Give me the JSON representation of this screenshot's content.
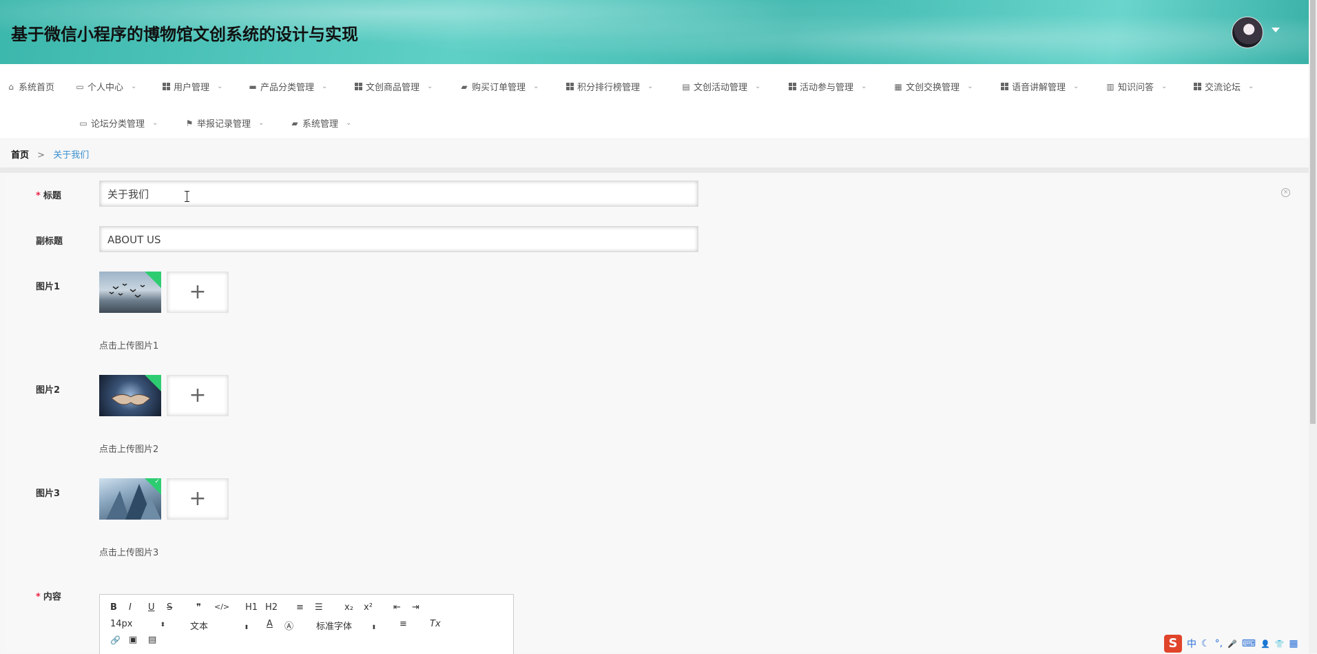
{
  "header": {
    "title": "基于微信小程序的博物馆文创系统的设计与实现"
  },
  "nav": {
    "row1": [
      {
        "label": "系统首页",
        "icon": "home-icon",
        "dropdown": false
      },
      {
        "label": "个人中心",
        "icon": "card-icon",
        "dropdown": true
      },
      {
        "label": "用户管理",
        "icon": "grid-icon",
        "dropdown": true
      },
      {
        "label": "产品分类管理",
        "icon": "comment-icon",
        "dropdown": true
      },
      {
        "label": "文创商品管理",
        "icon": "grid-icon",
        "dropdown": true
      },
      {
        "label": "购买订单管理",
        "icon": "briefcase-icon",
        "dropdown": true
      },
      {
        "label": "积分排行榜管理",
        "icon": "grid-icon",
        "dropdown": true
      },
      {
        "label": "文创活动管理",
        "icon": "clipboard-icon",
        "dropdown": true
      },
      {
        "label": "活动参与管理",
        "icon": "grid-icon",
        "dropdown": true
      },
      {
        "label": "文创交换管理",
        "icon": "table-icon",
        "dropdown": true
      },
      {
        "label": "语音讲解管理",
        "icon": "grid-icon",
        "dropdown": true
      },
      {
        "label": "知识问答",
        "icon": "books-icon",
        "dropdown": true
      },
      {
        "label": "交流论坛",
        "icon": "grid-icon",
        "dropdown": true
      }
    ],
    "row2": [
      {
        "label": "论坛分类管理",
        "icon": "monitor-icon",
        "dropdown": true
      },
      {
        "label": "举报记录管理",
        "icon": "flag-icon",
        "dropdown": true
      },
      {
        "label": "系统管理",
        "icon": "folder-icon",
        "dropdown": true
      }
    ]
  },
  "breadcrumb": {
    "home": "首页",
    "separator": ">",
    "current": "关于我们"
  },
  "form": {
    "title": {
      "label": "标题",
      "required": "*",
      "value": "关于我们"
    },
    "subtitle": {
      "label": "副标题",
      "value": "ABOUT US"
    },
    "images": [
      {
        "label": "图片1",
        "hint": "点击上传图片1",
        "plus": "+"
      },
      {
        "label": "图片2",
        "hint": "点击上传图片2",
        "plus": "+"
      },
      {
        "label": "图片3",
        "hint": "点击上传图片3",
        "plus": "+"
      }
    ],
    "content": {
      "label": "内容",
      "required": "*"
    }
  },
  "editor": {
    "row1": [
      "B",
      "I",
      "U",
      "S",
      "❞",
      "</>",
      "H1",
      "H2",
      "≡",
      "☰",
      "x₂",
      "x²",
      "⇤",
      "⇥"
    ],
    "font_size": "14px",
    "format": "文本",
    "font_family": "标准字体",
    "row2_icons": [
      "A",
      "Ⓐ",
      "≡",
      "Tx"
    ],
    "row3": [
      "🔗",
      "▣",
      "▤"
    ]
  },
  "ime": {
    "logo": "S",
    "mode": "中",
    "icons": [
      "☾",
      "°,",
      "🎤",
      "⌨",
      "👤",
      "👕",
      "▦"
    ]
  },
  "colors": {
    "accent": "#3a8fd0",
    "header": "#4cc3b8",
    "required": "#ee2244",
    "badge": "#2ecc71"
  }
}
